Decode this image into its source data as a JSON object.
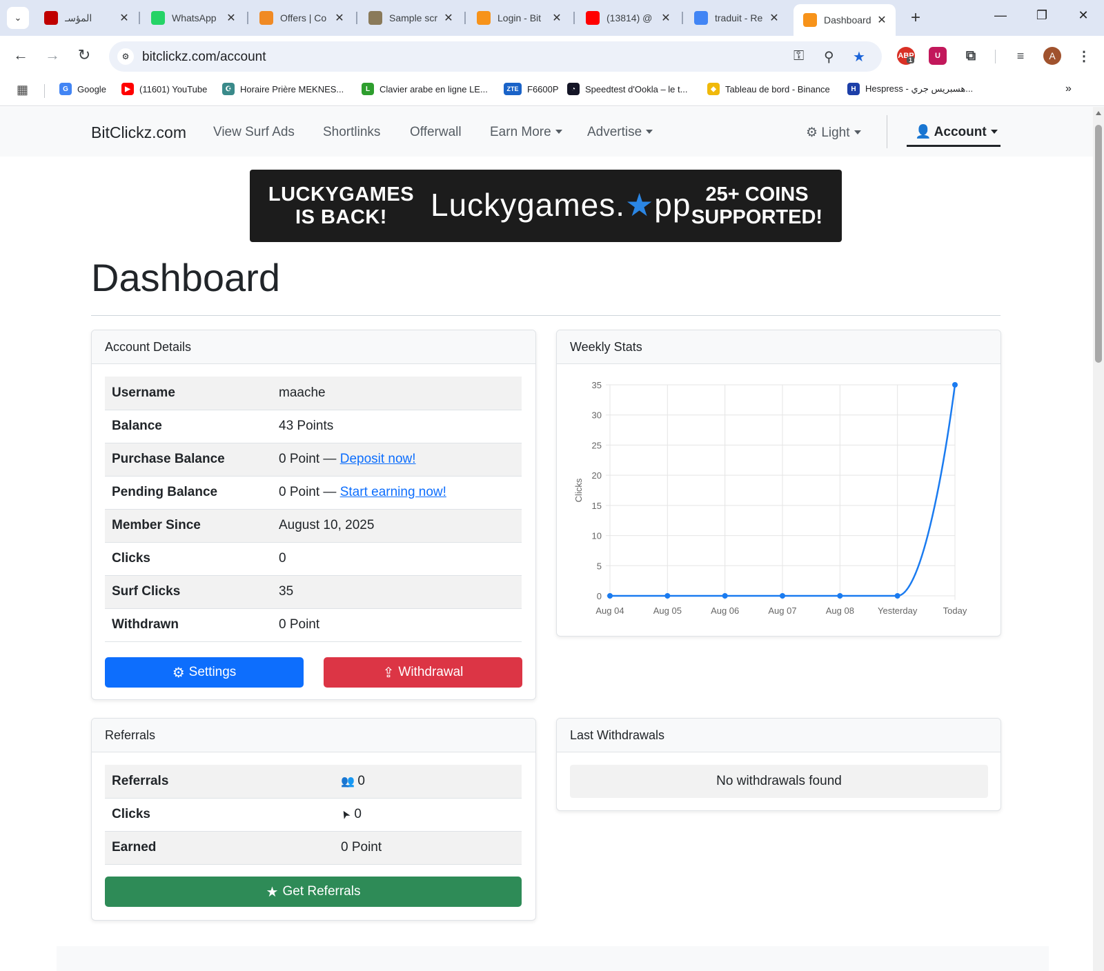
{
  "browser": {
    "tabs": [
      {
        "title": "المؤسـ",
        "favicon_color": "#c00000",
        "active": false
      },
      {
        "title": "WhatsApp",
        "favicon_color": "#25d366",
        "active": false
      },
      {
        "title": "Offers | Co",
        "favicon_color": "#f08a24",
        "active": false
      },
      {
        "title": "Sample scr",
        "favicon_color": "#8a7a5a",
        "active": false
      },
      {
        "title": "Login - Bit",
        "favicon_color": "#f7931a",
        "active": false
      },
      {
        "title": "(13814) @",
        "favicon_color": "#ff0000",
        "active": false
      },
      {
        "title": "traduit - Re",
        "favicon_color": "#4285f4",
        "active": false
      },
      {
        "title": "Dashboard",
        "favicon_color": "#f7931a",
        "active": true
      }
    ],
    "url": "bitclickz.com/account",
    "bookmarks": [
      {
        "label": "Google",
        "color": "#4285f4",
        "glyph": "G"
      },
      {
        "label": "(11601) YouTube",
        "color": "#ff0000",
        "glyph": "▶"
      },
      {
        "label": "Horaire Prière MEKNES...",
        "color": "#3a8a8a",
        "glyph": "☪"
      },
      {
        "label": "Clavier arabe en ligne LE...",
        "color": "#2e9e2e",
        "glyph": "L"
      },
      {
        "label": "F6600P",
        "color": "#1a63c8",
        "glyph": "ZTE"
      },
      {
        "label": "Speedtest d'Ookla – le t...",
        "color": "#141526",
        "glyph": "◔"
      },
      {
        "label": "Tableau de bord - Binance",
        "color": "#f0b90b",
        "glyph": "◆"
      },
      {
        "label": "Hespress - هسبريس جري...",
        "color": "#1d3fa8",
        "glyph": "H"
      }
    ],
    "profile_initial": "A",
    "ext_badge": "1"
  },
  "site": {
    "brand": "BitClickz.com",
    "nav": [
      "View Surf Ads",
      "Shortlinks",
      "Offerwall",
      "Earn More",
      "Advertise"
    ],
    "theme_label": "Light",
    "account_label": "Account"
  },
  "banner": {
    "left": "LUCKYGAMES IS BACK!",
    "middle_a": "Luckygames.",
    "middle_b": "pp",
    "right": "25+ COINS SUPPORTED!"
  },
  "page": {
    "title": "Dashboard"
  },
  "account_details": {
    "header": "Account Details",
    "rows": [
      {
        "label": "Username",
        "value": "maache"
      },
      {
        "label": "Balance",
        "value": "43 Points"
      },
      {
        "label": "Purchase Balance",
        "value": "0 Point — ",
        "link": "Deposit now!"
      },
      {
        "label": "Pending Balance",
        "value": "0 Point — ",
        "link": "Start earning now!"
      },
      {
        "label": "Member Since",
        "value": "August 10, 2025"
      },
      {
        "label": "Clicks",
        "value": "0"
      },
      {
        "label": "Surf Clicks",
        "value": "35"
      },
      {
        "label": "Withdrawn",
        "value": "0 Point"
      }
    ],
    "settings_button": "Settings",
    "withdrawal_button": "Withdrawal",
    "colors": {
      "settings": "#0d6efd",
      "withdrawal": "#dc3545"
    }
  },
  "weekly_stats": {
    "header": "Weekly Stats"
  },
  "chart_data": {
    "type": "line",
    "categories": [
      "Aug 04",
      "Aug 05",
      "Aug 06",
      "Aug 07",
      "Aug 08",
      "Yesterday",
      "Today"
    ],
    "values": [
      0,
      0,
      0,
      0,
      0,
      0,
      35
    ],
    "title": "",
    "xlabel": "",
    "ylabel": "Clicks",
    "ylim": [
      0,
      35
    ],
    "yticks": [
      0,
      5,
      10,
      15,
      20,
      25,
      30,
      35
    ],
    "grid": true,
    "color": "#1a7bf0"
  },
  "referrals": {
    "header": "Referrals",
    "rows": [
      {
        "label": "Referrals",
        "value": "0",
        "icon": "users-icon"
      },
      {
        "label": "Clicks",
        "value": "0",
        "icon": "cursor-icon"
      },
      {
        "label": "Earned",
        "value": "0 Point"
      }
    ],
    "button": "Get Referrals",
    "button_color": "#2e8b57"
  },
  "last_withdrawals": {
    "header": "Last Withdrawals",
    "empty": "No withdrawals found"
  }
}
